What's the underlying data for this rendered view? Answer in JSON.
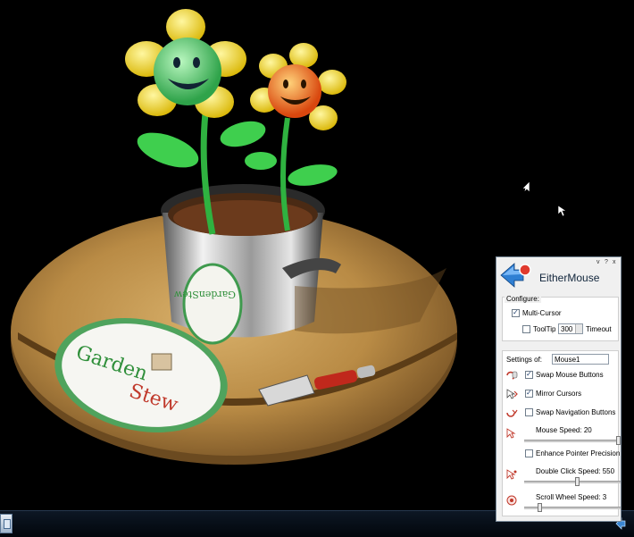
{
  "app": {
    "title": "EitherMouse",
    "window_controls": [
      "v",
      "?",
      "x"
    ]
  },
  "configure": {
    "label": "Configure:",
    "multi_cursor": {
      "label": "Multi-Cursor",
      "checked": true
    },
    "tooltip": {
      "label": "ToolTip",
      "checked": false
    },
    "timeout": {
      "value": "300",
      "label": "Timeout"
    }
  },
  "settings": {
    "label": "Settings of:",
    "device": "Mouse1",
    "swap_mouse_buttons": {
      "label": "Swap Mouse Buttons",
      "checked": true
    },
    "mirror_cursors": {
      "label": "Mirror Cursors",
      "checked": true
    },
    "swap_navigation_buttons": {
      "label": "Swap Navigation Buttons",
      "checked": false
    },
    "mouse_speed": {
      "label": "Mouse Speed: 20",
      "value": 20,
      "max": 20
    },
    "enhance_pointer_precision": {
      "label": "Enhance Pointer Precision",
      "checked": false
    },
    "double_click_speed": {
      "label": "Double Click Speed: 550",
      "level": 0.55
    },
    "scroll_wheel_speed": {
      "label": "Scroll Wheel Speed: 3",
      "level": 0.15
    }
  },
  "wallpaper": {
    "brand": [
      "Garden",
      "Stew"
    ],
    "pot_label": "GardenStew",
    "colors": {
      "brand_green": "#2f8f3a",
      "brand_red": "#c0392b",
      "wood": "#c9a05a"
    }
  }
}
